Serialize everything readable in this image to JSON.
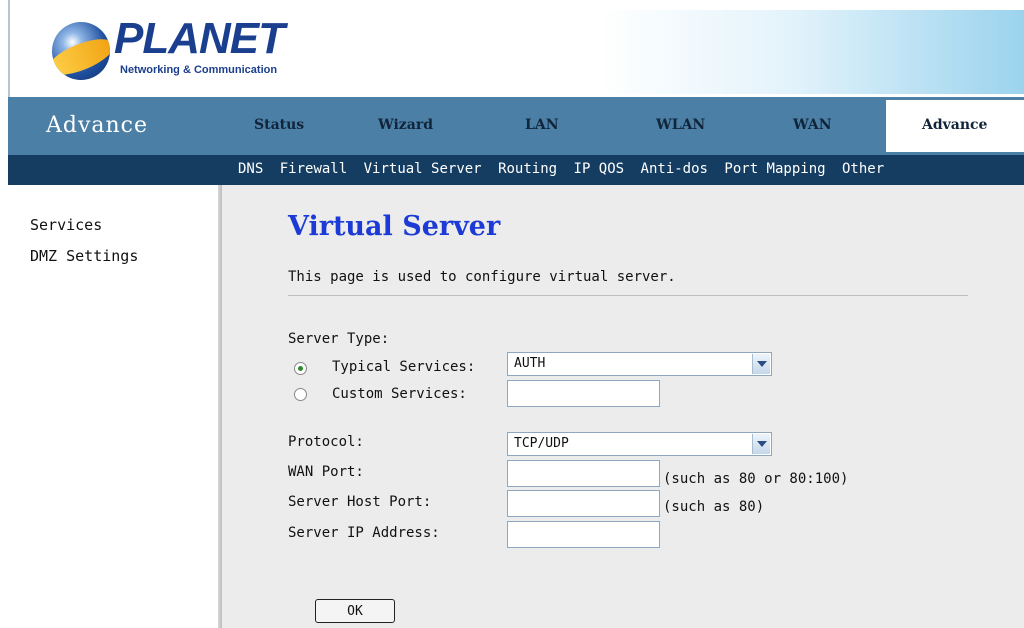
{
  "logo": {
    "brand": "PLANET",
    "tagline": "Networking & Communication"
  },
  "nav": {
    "section_title": "Advance",
    "tabs": [
      {
        "label": "Status"
      },
      {
        "label": "Wizard"
      },
      {
        "label": "LAN"
      },
      {
        "label": "WLAN"
      },
      {
        "label": "WAN"
      },
      {
        "label": "Advance"
      }
    ],
    "active_tab": "Advance"
  },
  "subnav": {
    "items": [
      "DNS",
      "Firewall",
      "Virtual Server",
      "Routing",
      "IP QOS",
      "Anti-dos",
      "Port Mapping",
      "Other"
    ]
  },
  "sidebar": {
    "items": [
      {
        "label": "Services"
      },
      {
        "label": "DMZ Settings"
      }
    ]
  },
  "main": {
    "title": "Virtual Server",
    "description": "This page is used to configure virtual server.",
    "server_type_label": "Server Type:",
    "typical_label": "Typical Services:",
    "typical_selected": true,
    "typical_value": "AUTH",
    "custom_label": "Custom Services:",
    "custom_value": "",
    "protocol_label": "Protocol:",
    "protocol_value": "TCP/UDP",
    "wan_port_label": "WAN Port:",
    "wan_port_value": "",
    "wan_port_hint": "(such as 80 or 80:100)",
    "host_port_label": "Server Host Port:",
    "host_port_value": "",
    "host_port_hint": "(such as 80)",
    "ip_label": "Server IP Address:",
    "ip_value": "",
    "ok_label": "OK"
  },
  "colors": {
    "nav_bar": "#4b7fa6",
    "subnav_bar": "#153d62",
    "title_blue": "#1b3ad6",
    "content_bg": "#ececec"
  }
}
